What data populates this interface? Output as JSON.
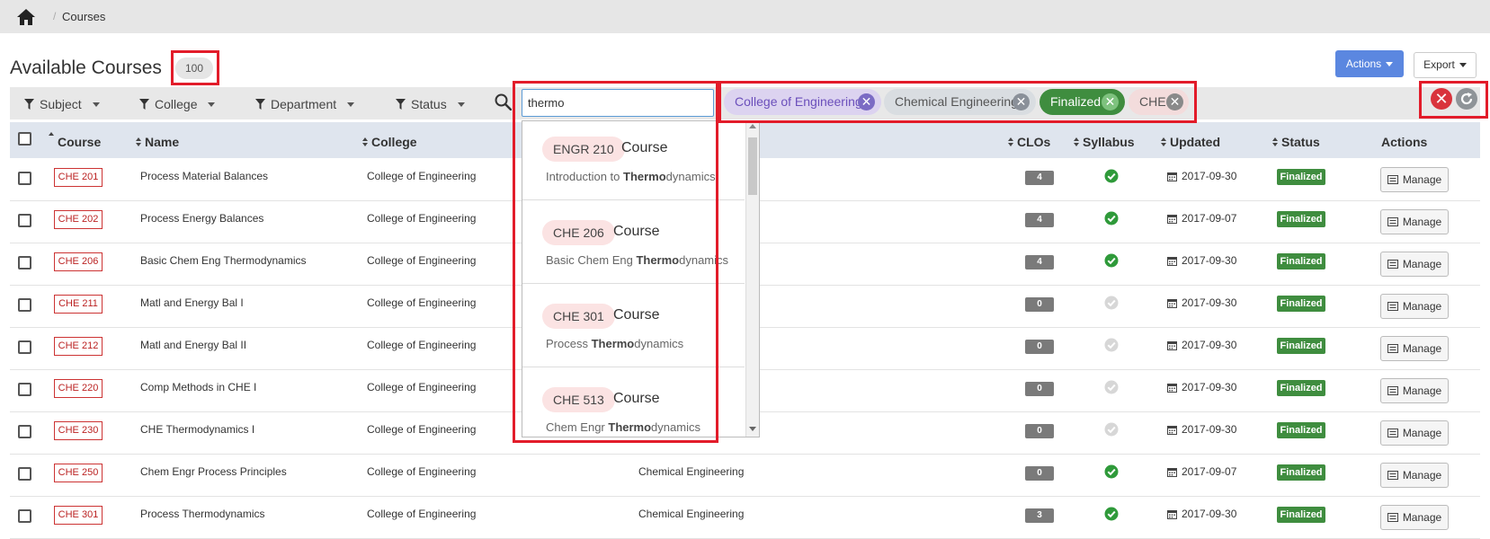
{
  "breadcrumb": {
    "home_icon": "home-icon",
    "current": "Courses"
  },
  "page": {
    "title": "Available Courses",
    "count": "100"
  },
  "toolbar": {
    "actions_label": "Actions",
    "export_label": "Export"
  },
  "filters": {
    "subject": "Subject",
    "college": "College",
    "department": "Department",
    "status": "Status"
  },
  "search": {
    "value": "thermo"
  },
  "chips": [
    {
      "label": "College of Engineering"
    },
    {
      "label": "Chemical Engineering"
    },
    {
      "label": "Finalized"
    },
    {
      "label": "CHE"
    }
  ],
  "columns": {
    "course": "Course",
    "name": "Name",
    "college": "College",
    "clos": "CLOs",
    "syllabus": "Syllabus",
    "updated": "Updated",
    "status": "Status",
    "actions": "Actions"
  },
  "rows": [
    {
      "code": "CHE 201",
      "name": "Process Material Balances",
      "college": "College of Engineering",
      "department": "",
      "clos": "4",
      "syllabus": true,
      "updated": "2017-09-30",
      "status": "Finalized",
      "action": "Manage"
    },
    {
      "code": "CHE 202",
      "name": "Process Energy Balances",
      "college": "College of Engineering",
      "department": "",
      "clos": "4",
      "syllabus": true,
      "updated": "2017-09-07",
      "status": "Finalized",
      "action": "Manage"
    },
    {
      "code": "CHE 206",
      "name": "Basic Chem Eng Thermodynamics",
      "college": "College of Engineering",
      "department": "",
      "clos": "4",
      "syllabus": true,
      "updated": "2017-09-30",
      "status": "Finalized",
      "action": "Manage"
    },
    {
      "code": "CHE 211",
      "name": "Matl and Energy Bal I",
      "college": "College of Engineering",
      "department": "",
      "clos": "0",
      "syllabus": false,
      "updated": "2017-09-30",
      "status": "Finalized",
      "action": "Manage"
    },
    {
      "code": "CHE 212",
      "name": "Matl and Energy Bal II",
      "college": "College of Engineering",
      "department": "",
      "clos": "0",
      "syllabus": false,
      "updated": "2017-09-30",
      "status": "Finalized",
      "action": "Manage"
    },
    {
      "code": "CHE 220",
      "name": "Comp Methods in CHE I",
      "college": "College of Engineering",
      "department": "",
      "clos": "0",
      "syllabus": false,
      "updated": "2017-09-30",
      "status": "Finalized",
      "action": "Manage"
    },
    {
      "code": "CHE 230",
      "name": "CHE Thermodynamics I",
      "college": "College of Engineering",
      "department": "",
      "clos": "0",
      "syllabus": false,
      "updated": "2017-09-30",
      "status": "Finalized",
      "action": "Manage"
    },
    {
      "code": "CHE 250",
      "name": "Chem Engr Process Principles",
      "college": "College of Engineering",
      "department": "Chemical Engineering",
      "clos": "0",
      "syllabus": true,
      "updated": "2017-09-07",
      "status": "Finalized",
      "action": "Manage"
    },
    {
      "code": "CHE 301",
      "name": "Process Thermodynamics",
      "college": "College of Engineering",
      "department": "Chemical Engineering",
      "clos": "3",
      "syllabus": true,
      "updated": "2017-09-30",
      "status": "Finalized",
      "action": "Manage"
    }
  ],
  "suggestions": [
    {
      "code": "ENGR 210",
      "type": "Course",
      "pre": "Introduction to ",
      "match": "Thermo",
      "post": "dynamics"
    },
    {
      "code": "CHE 206",
      "type": "Course",
      "pre": "Basic Chem Eng ",
      "match": "Thermo",
      "post": "dynamics"
    },
    {
      "code": "CHE 301",
      "type": "Course",
      "pre": "Process ",
      "match": "Thermo",
      "post": "dynamics"
    },
    {
      "code": "CHE 513",
      "type": "Course",
      "pre": "Chem Engr ",
      "match": "Thermo",
      "post": "dynamics"
    }
  ],
  "colors": {
    "accent": "#5b87e0",
    "finalized": "#3f8d3f",
    "highlight": "#e21c2a",
    "clear": "#d9333c"
  }
}
